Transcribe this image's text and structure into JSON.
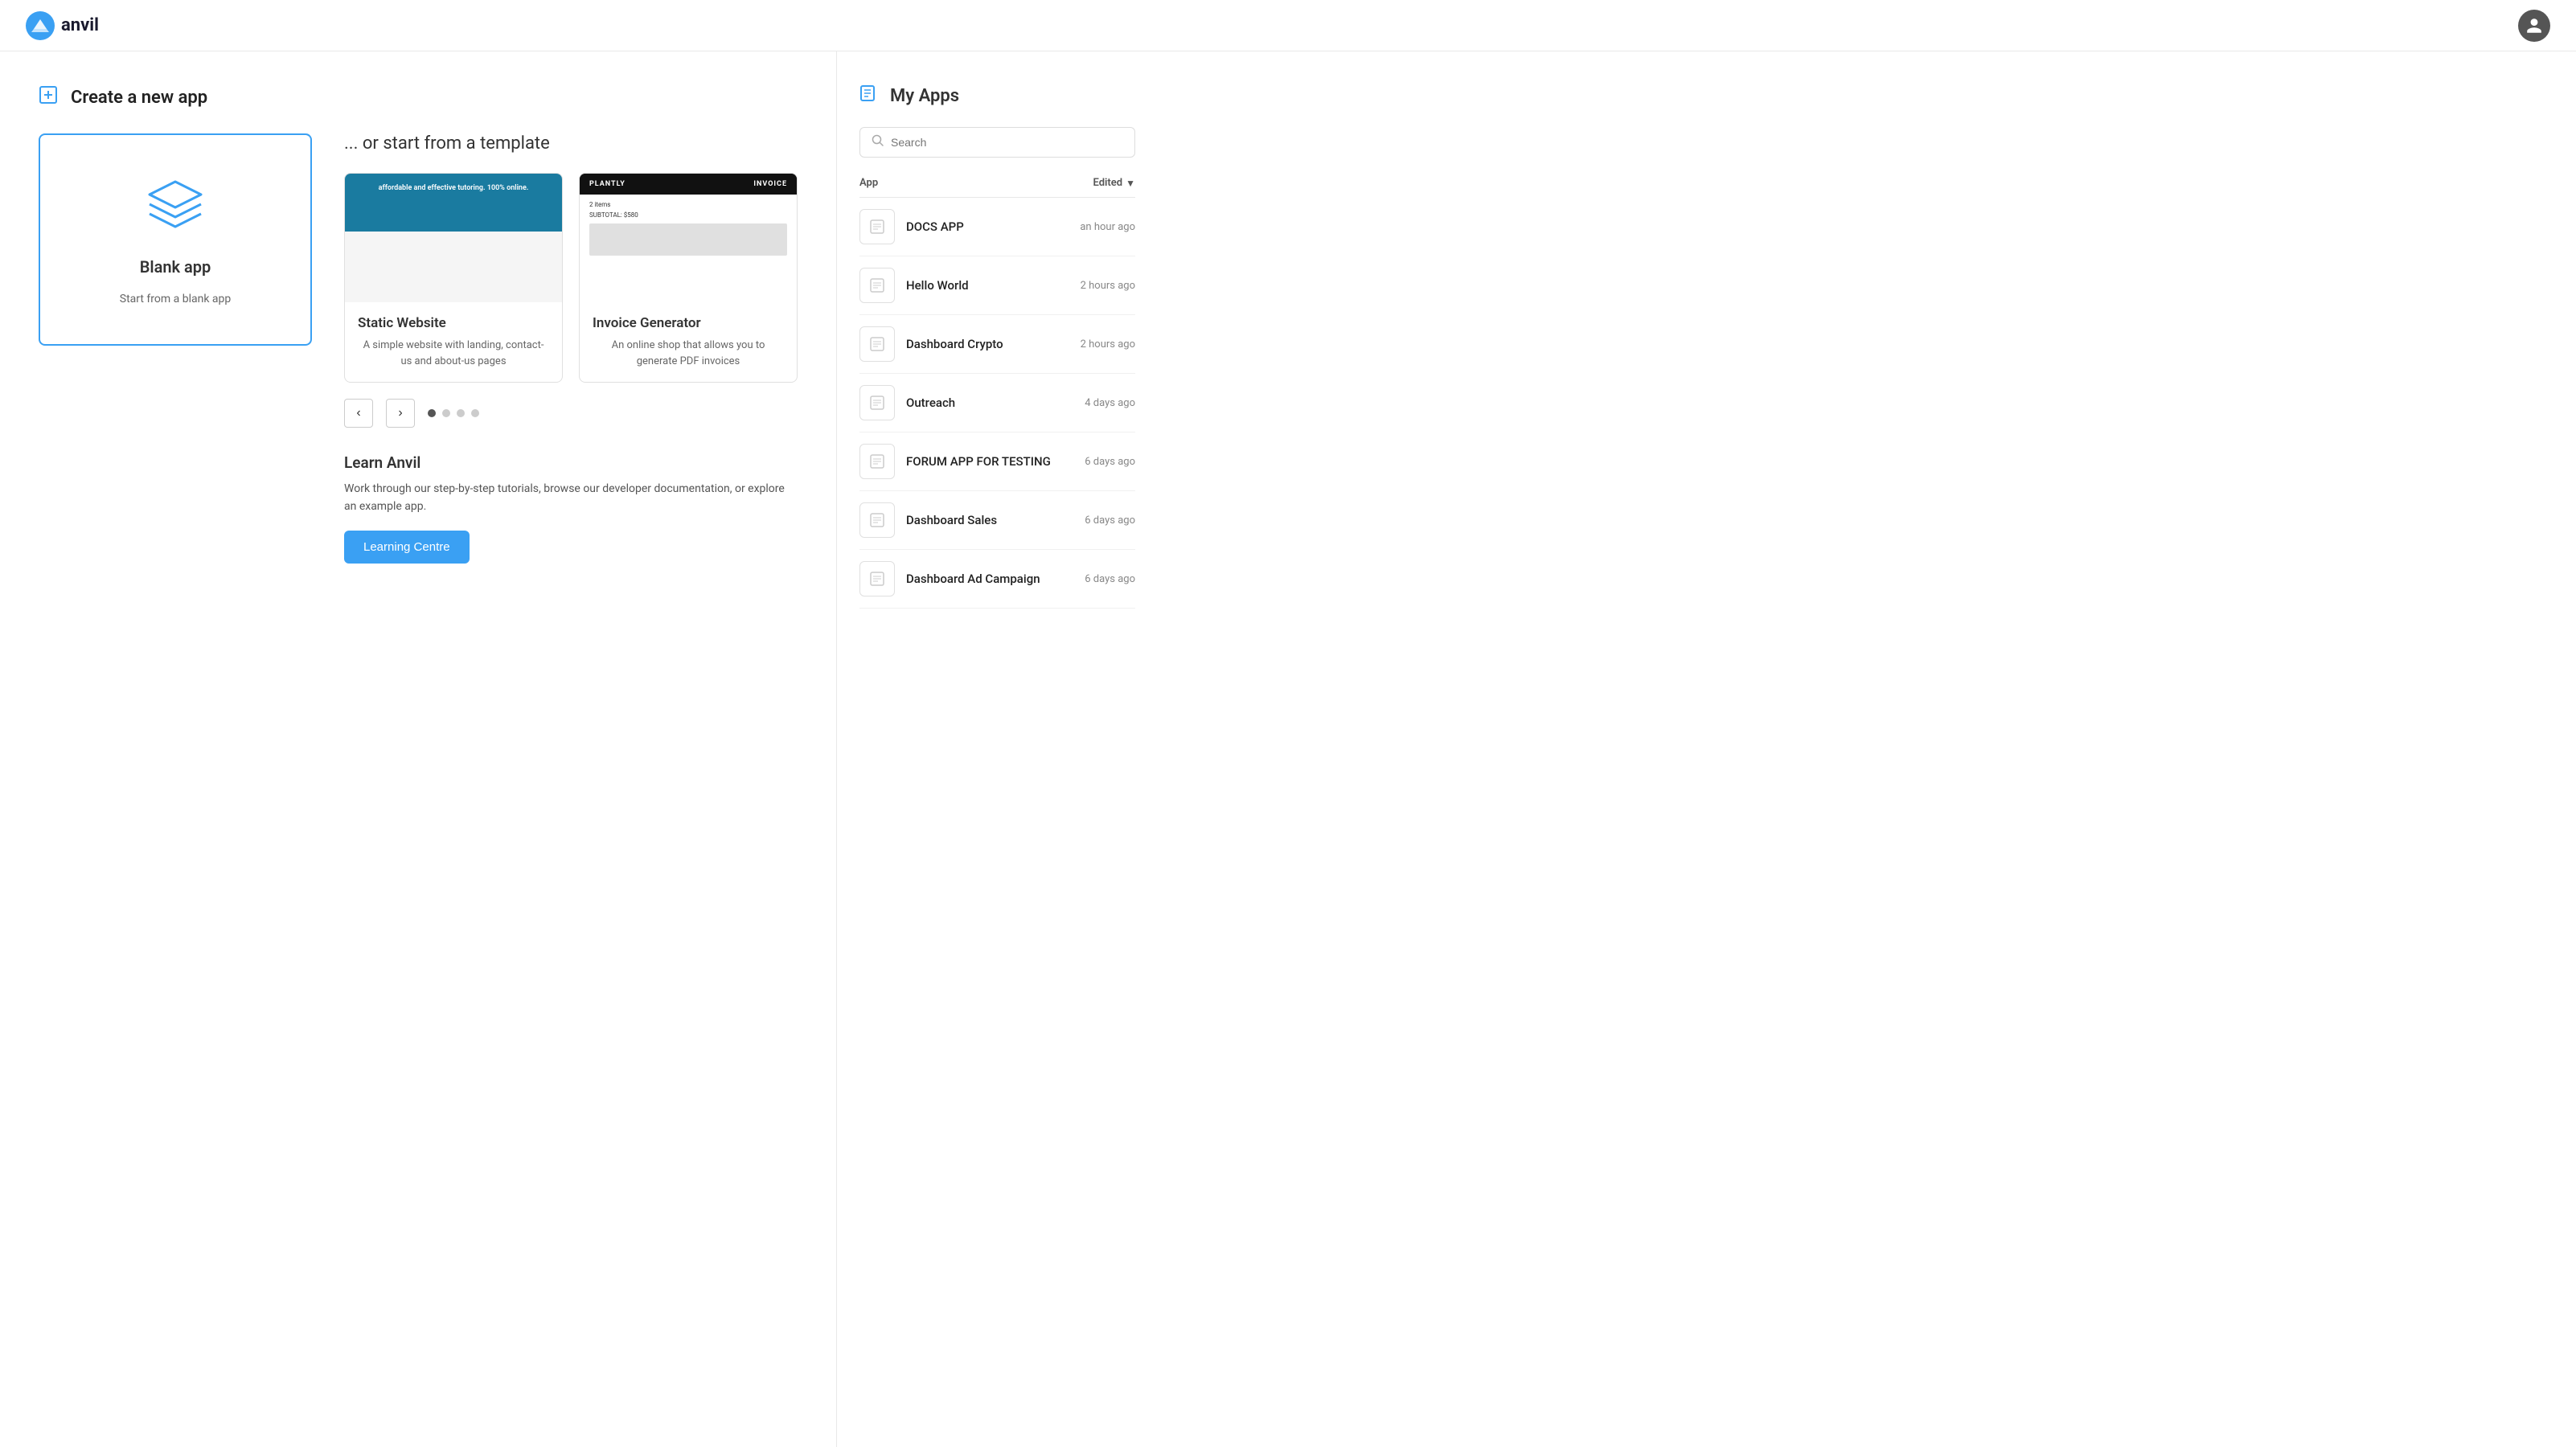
{
  "header": {
    "logo_text": "anvil",
    "avatar_label": "User avatar"
  },
  "create_section": {
    "title": "Create a new app",
    "blank_card": {
      "title": "Blank app",
      "subtitle": "Start from a blank app"
    }
  },
  "template_section": {
    "heading": "... or start from a template",
    "templates": [
      {
        "id": "static-website",
        "name": "Static Website",
        "description": "A simple website with landing, contact-us and about-us pages",
        "type": "static"
      },
      {
        "id": "invoice-generator",
        "name": "Invoice Generator",
        "description": "An online shop that allows you to generate PDF invoices",
        "type": "invoice"
      }
    ],
    "carousel_dots": [
      true,
      false,
      false,
      false
    ]
  },
  "learn_section": {
    "title": "Learn Anvil",
    "description": "Work through our step-by-step tutorials, browse our developer documentation, or explore an example app.",
    "button_label": "Learning Centre"
  },
  "my_apps": {
    "title": "My Apps",
    "search_placeholder": "Search",
    "col_app": "App",
    "col_edited": "Edited",
    "apps": [
      {
        "name": "DOCS APP",
        "edited": "an hour ago"
      },
      {
        "name": "Hello World",
        "edited": "2 hours ago"
      },
      {
        "name": "Dashboard Crypto",
        "edited": "2 hours ago"
      },
      {
        "name": "Outreach",
        "edited": "4 days ago"
      },
      {
        "name": "FORUM APP FOR TESTING",
        "edited": "6 days ago"
      },
      {
        "name": "Dashboard Sales",
        "edited": "6 days ago"
      },
      {
        "name": "Dashboard Ad Campaign",
        "edited": "6 days ago"
      }
    ]
  }
}
